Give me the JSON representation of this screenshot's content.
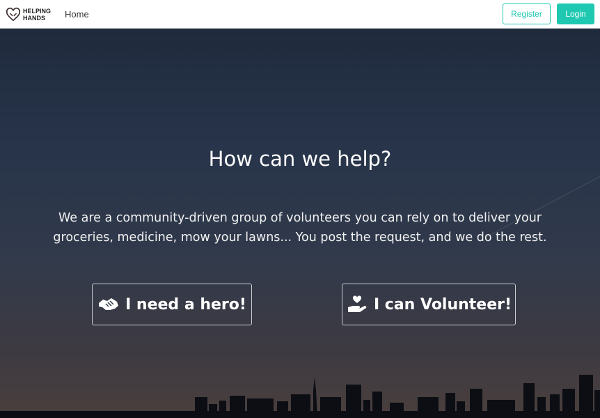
{
  "nav": {
    "logo_text_line1": "HELPING",
    "logo_text_line2": "HANDS",
    "logo_icon": "heart-hands-icon",
    "home_label": "Home",
    "register_label": "Register",
    "login_label": "Login"
  },
  "hero": {
    "title": "How can we help?",
    "description": "We are a community-driven group of volunteers you can rely on to deliver your groceries, medicine, mow your lawns... You post the request, and we do the rest.",
    "need_hero_label": "I need a hero!",
    "need_hero_icon": "handshake-icon",
    "volunteer_label": "I can Volunteer!",
    "volunteer_icon": "hand-holding-heart-icon"
  },
  "colors": {
    "accent": "#1fc8b1",
    "hero_top": "#1f2a3c",
    "hero_bottom": "#4a3f3d"
  }
}
